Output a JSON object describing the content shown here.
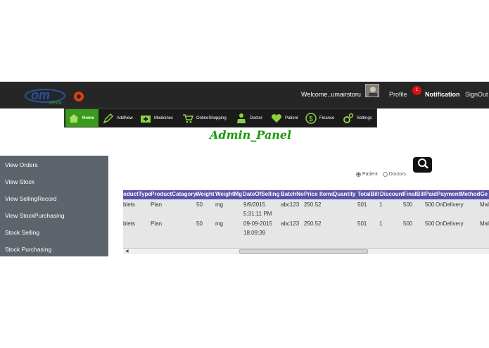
{
  "header": {
    "logo_text": "om",
    "logo_sub": "Medic",
    "welcome": "Welcome..umairstoru",
    "profile": "Profile",
    "notification_count": "1",
    "notification": "Notification",
    "signout": "SignOut"
  },
  "menu": [
    {
      "label": "Home",
      "icon": "home-icon"
    },
    {
      "label": "AddNew",
      "icon": "pencil-icon"
    },
    {
      "label": "Medicines",
      "icon": "medkit-icon"
    },
    {
      "label": "OnlineShopping",
      "icon": "cart-icon"
    },
    {
      "label": "Doctor",
      "icon": "doctor-icon"
    },
    {
      "label": "Patient",
      "icon": "heart-icon"
    },
    {
      "label": "Finance",
      "icon": "dollar-icon"
    },
    {
      "label": "Settings",
      "icon": "gear-icon"
    }
  ],
  "page_title": "Admin_Panel",
  "sidebar": [
    "View Orders",
    "View Stock",
    "View SellingRecord",
    "View StockPurchasing",
    "Stock Selling",
    "Stock Purchasing"
  ],
  "filter": {
    "patient_label": "Patient",
    "doctors_label": "Doctors",
    "selected": "Patient"
  },
  "grid": {
    "headers": [
      "oductType",
      "ProductCatagory",
      "Weight",
      "WeightMg",
      "DateOfSelling",
      "BatchNo",
      "Price",
      "Items",
      "Quantity",
      "TotalBill",
      "Discount",
      "FinalBill",
      "PaidPayment",
      "MethodGe"
    ],
    "rows": [
      {
        "type": "blets",
        "category": "Plan",
        "weight": "50",
        "mg": "mg",
        "date1": "9/9/2015",
        "date2": "5:31:11 PM",
        "batch": "abc123",
        "price": "250.52",
        "total": "501",
        "discount": "1",
        "final": "500",
        "paid": "500",
        "method": "OnDelivery",
        "ge": "Mal"
      },
      {
        "type": "blets",
        "category": "Plan",
        "weight": "50",
        "mg": "mg",
        "date1": "09-09-2015",
        "date2": "18:09:39",
        "batch": "abc123",
        "price": "250.52",
        "total": "501",
        "discount": "1",
        "final": "500",
        "paid": "500",
        "method": "OnDelivery",
        "ge": "Mal"
      }
    ]
  },
  "colors": {
    "topbar": "#262626",
    "menu_active": "#3a9a1c",
    "title": "#1a9a0a",
    "sidebar": "#5e646c",
    "grid_header": "#5a52ac",
    "grid_body": "#e6e6e6"
  }
}
